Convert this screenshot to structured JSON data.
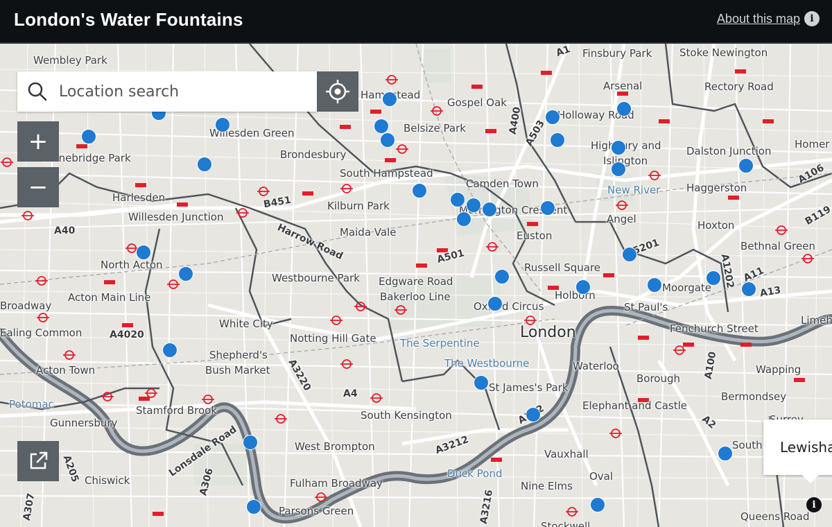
{
  "header": {
    "title": "London's Water Fountains",
    "about_label": "About this map",
    "about_icon": "info-icon"
  },
  "search": {
    "placeholder": "Location search",
    "value": "",
    "icon": "search-icon"
  },
  "controls": {
    "locate_icon": "locate-icon",
    "zoom_in": "+",
    "zoom_out": "−",
    "external_icon": "external-link-icon",
    "attribution_icon": "info-icon"
  },
  "popup": {
    "text": "Lewisha"
  },
  "colors": {
    "header_bg": "#0d1114",
    "button_bg": "#5a6167",
    "fountain": "#1f7ad1",
    "river": "#6a7178",
    "map_bg": "#e8e6e1"
  },
  "place_labels": [
    "Wembley Park",
    "Finsbury Park",
    "Stoke Newington",
    "Hampstead",
    "Gospel Oak",
    "Arsenal",
    "Rectory Road",
    "Holloway Road",
    "Belsize Park",
    "Highbury and",
    "Islington",
    "Dalston Junction",
    "Homer",
    "Willesden Green",
    "Brondesbury",
    "Stonebridge Park",
    "South Hampstead",
    "Camden Town",
    "Haggerston",
    "Harlesden",
    "Kilburn Park",
    "Mornington Crescent",
    "Angel",
    "Hoxton",
    "Willesden Junction",
    "Maida Vale",
    "Euston",
    "Bethnal Green",
    "North Acton",
    "Russell Square",
    "Westbourne Park",
    "Edgware Road",
    "Moorgate",
    "Acton Main Line",
    "Bakerloo Line",
    "Oxford Circus",
    "Holborn",
    "St Paul's",
    "Broadway",
    "White City",
    "London",
    "Fenchurch Street",
    "Limeh",
    "Ealing Common",
    "Notting Hill Gate",
    "Shepherd's",
    "Bush Market",
    "Waterloo",
    "Borough",
    "Wapping",
    "Acton Town",
    "St James's Park",
    "Bermondsey",
    "Stamford Brook",
    "Elephant and Castle",
    "South Kensington",
    "Gunnersbury",
    "West Brompton",
    "South",
    "Vauxhall",
    "Chiswick",
    "Fulham Broadway",
    "Oval",
    "Nine Elms",
    "Parsons Green",
    "Stockwell",
    "Queens Road",
    "Surrey"
  ],
  "water_labels": [
    "New River",
    "The Serpentine",
    "The Westbourne",
    "Potomac",
    "Duck Pond"
  ],
  "road_labels": [
    "A1",
    "A400",
    "A503",
    "A106",
    "B119",
    "B451",
    "A40",
    "Harrow Road",
    "A501",
    "A5201",
    "A1202",
    "A11",
    "A13",
    "A4020",
    "A3220",
    "A4",
    "A202",
    "A100",
    "A3212",
    "A2",
    "A306",
    "Lonsdale Road",
    "A3216",
    "A307",
    "A205"
  ],
  "fountains": [
    {
      "id": 1,
      "lon": -0.1705,
      "lat": 51.5568
    },
    {
      "id": 2,
      "lon": -0.1478,
      "lat": 51.5521
    },
    {
      "id": 3,
      "lon": -0.2195,
      "lat": 51.5471
    },
    {
      "id": 4,
      "lon": -0.1997,
      "lat": 51.5429
    },
    {
      "id": 5,
      "lon": -0.2413,
      "lat": 51.5387
    },
    {
      "id": 6,
      "lon": -0.1504,
      "lat": 51.5424
    },
    {
      "id": 7,
      "lon": -0.0969,
      "lat": 51.5457
    },
    {
      "id": 8,
      "lon": -0.0748,
      "lat": 51.5488
    },
    {
      "id": 9,
      "lon": -0.1483,
      "lat": 51.5375
    },
    {
      "id": 10,
      "lon": -0.0954,
      "lat": 51.5375
    },
    {
      "id": 11,
      "lon": -0.0764,
      "lat": 51.5348
    },
    {
      "id": 12,
      "lon": -0.2054,
      "lat": 51.5288
    },
    {
      "id": 13,
      "lon": -0.0764,
      "lat": 51.5271
    },
    {
      "id": 14,
      "lon": -0.0367,
      "lat": 51.5283
    },
    {
      "id": 15,
      "lon": -0.1385,
      "lat": 51.5195
    },
    {
      "id": 16,
      "lon": -0.1266,
      "lat": 51.5162
    },
    {
      "id": 17,
      "lon": -0.1215,
      "lat": 51.5143
    },
    {
      "id": 18,
      "lon": -0.1167,
      "lat": 51.5127
    },
    {
      "id": 19,
      "lon": -0.0986,
      "lat": 51.5132
    },
    {
      "id": 20,
      "lon": -0.1246,
      "lat": 51.5092
    },
    {
      "id": 21,
      "lon": -0.2243,
      "lat": 51.4974
    },
    {
      "id": 22,
      "lon": -0.073,
      "lat": 51.4965
    },
    {
      "id": 23,
      "lon": -0.2112,
      "lat": 51.4895
    },
    {
      "id": 24,
      "lon": -0.047,
      "lat": 51.4882
    },
    {
      "id": 25,
      "lon": -0.1127,
      "lat": 51.4887
    },
    {
      "id": 26,
      "lon": -0.0874,
      "lat": 51.4849
    },
    {
      "id": 27,
      "lon": -0.0653,
      "lat": 51.4857
    },
    {
      "id": 28,
      "lon": -0.036,
      "lat": 51.4841
    },
    {
      "id": 29,
      "lon": -0.115,
      "lat": 51.479
    },
    {
      "id": 30,
      "lon": -0.2161,
      "lat": 51.4622
    },
    {
      "id": 31,
      "lon": -0.1192,
      "lat": 51.4507
    },
    {
      "id": 32,
      "lon": -0.103,
      "lat": 51.4392
    },
    {
      "id": 33,
      "lon": -0.1912,
      "lat": 51.4292
    },
    {
      "id": 34,
      "lon": -0.0433,
      "lat": 51.4254
    },
    {
      "id": 35,
      "lon": -0.19,
      "lat": 51.4061
    },
    {
      "id": 36,
      "lon": -0.083,
      "lat": 51.4069
    }
  ]
}
